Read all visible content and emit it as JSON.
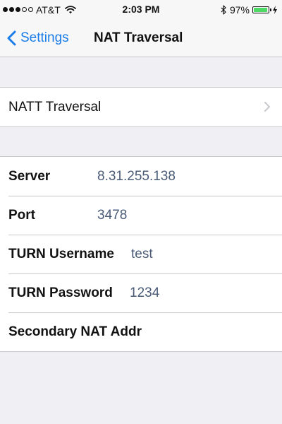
{
  "status_bar": {
    "carrier": "AT&T",
    "time": "2:03 PM",
    "battery_percent": "97%",
    "battery_level": 0.97,
    "signal_bars_filled": 3,
    "signal_bars_total": 5
  },
  "nav": {
    "back_label": "Settings",
    "title": "NAT Traversal"
  },
  "group1": {
    "items": [
      {
        "label": "NATT Traversal"
      }
    ]
  },
  "group2": {
    "fields": [
      {
        "label": "Server",
        "value": "8.31.255.138"
      },
      {
        "label": "Port",
        "value": "3478"
      },
      {
        "label": "TURN Username",
        "value": "test"
      },
      {
        "label": "TURN Password",
        "value": "1234"
      },
      {
        "label": "Secondary NAT Addr",
        "value": ""
      }
    ]
  },
  "colors": {
    "accent": "#1a7ce8",
    "value_text": "#4a5b77",
    "background": "#efeff4",
    "battery": "#4cd964"
  },
  "icons": [
    "signal-dots-icon",
    "wifi-icon",
    "bluetooth-icon",
    "battery-icon",
    "charging-bolt-icon",
    "back-chevron-icon",
    "chevron-right-icon"
  ]
}
